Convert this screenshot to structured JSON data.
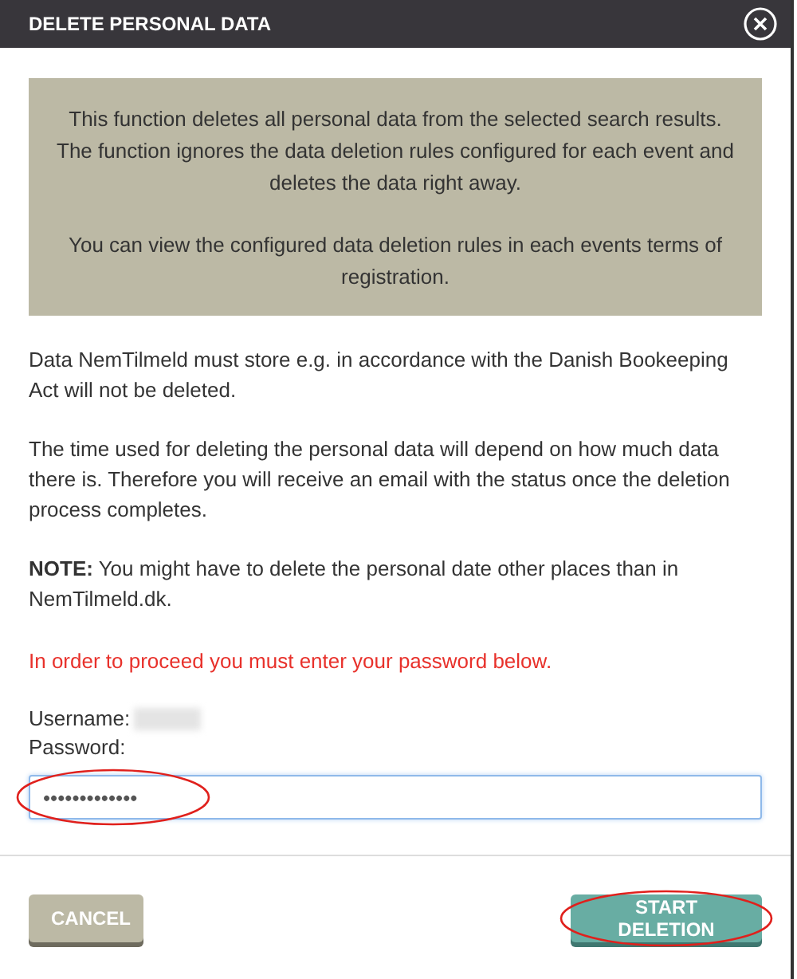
{
  "window": {
    "title": "DELETE PERSONAL DATA"
  },
  "notice": [
    "This function deletes all personal data from the selected search results. The function ignores the data deletion rules configured for each event and deletes the data right away.",
    "You can view the configured data deletion rules in each events terms of registration."
  ],
  "paragraphs": [
    {
      "kind": "plain",
      "text": "Data NemTilmeld must store e.g. in accordance with the Danish Bookeeping Act will not be deleted."
    },
    {
      "kind": "plain",
      "text": "The time used for deleting the personal data will depend on how much data there is. Therefore you will receive an email with the status once the deletion process completes."
    },
    {
      "kind": "plain",
      "text": "**NOTE:** You might have to delete the personal date other places than in NemTilmeld.dk."
    },
    {
      "kind": "warning",
      "text": "In order to proceed you must enter your password below."
    }
  ],
  "username": {
    "label": "Username:",
    "redacted": true
  },
  "password": {
    "label": "Password:",
    "value": "•••••••••••••",
    "annotated": true
  },
  "buttons": [
    {
      "kind": "cancel",
      "label": "CANCEL",
      "annotated": false
    },
    {
      "kind": "primary",
      "label": "START DELETION",
      "annotated": true
    }
  ]
}
